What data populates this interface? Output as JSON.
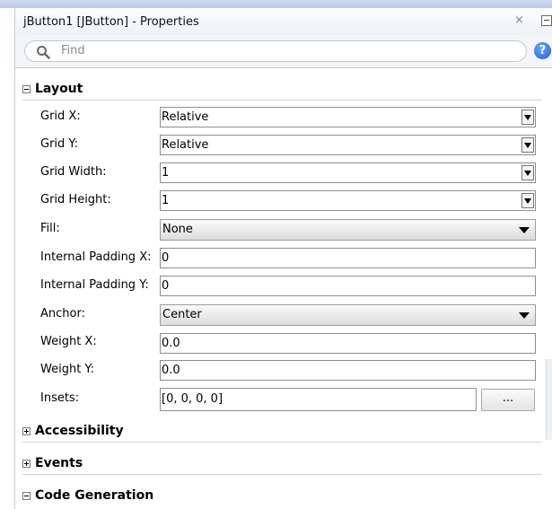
{
  "window": {
    "title": "jButton1 [JButton] - Properties",
    "close_label": "×"
  },
  "find": {
    "placeholder": "Find",
    "help_label": "?"
  },
  "sections": {
    "layout": "Layout",
    "accessibility": "Accessibility",
    "events": "Events",
    "code_generation": "Code Generation"
  },
  "properties": {
    "grid_x": {
      "label": "Grid X:",
      "value": "Relative"
    },
    "grid_y": {
      "label": "Grid Y:",
      "value": "Relative"
    },
    "grid_width": {
      "label": "Grid Width:",
      "value": "1"
    },
    "grid_height": {
      "label": "Grid Height:",
      "value": "1"
    },
    "fill": {
      "label": "Fill:",
      "value": "None"
    },
    "internal_padding_x": {
      "label": "Internal Padding X:",
      "value": "0"
    },
    "internal_padding_y": {
      "label": "Internal Padding Y:",
      "value": "0"
    },
    "anchor": {
      "label": "Anchor:",
      "value": "Center"
    },
    "weight_x": {
      "label": "Weight X:",
      "value": "0.0"
    },
    "weight_y": {
      "label": "Weight Y:",
      "value": "0.0"
    },
    "insets": {
      "label": "Insets:",
      "value": "[0, 0, 0, 0]",
      "button_label": "..."
    }
  },
  "colors": {
    "help_blue": "#1a5fd0",
    "accent_bar": "#b8c8e8"
  }
}
